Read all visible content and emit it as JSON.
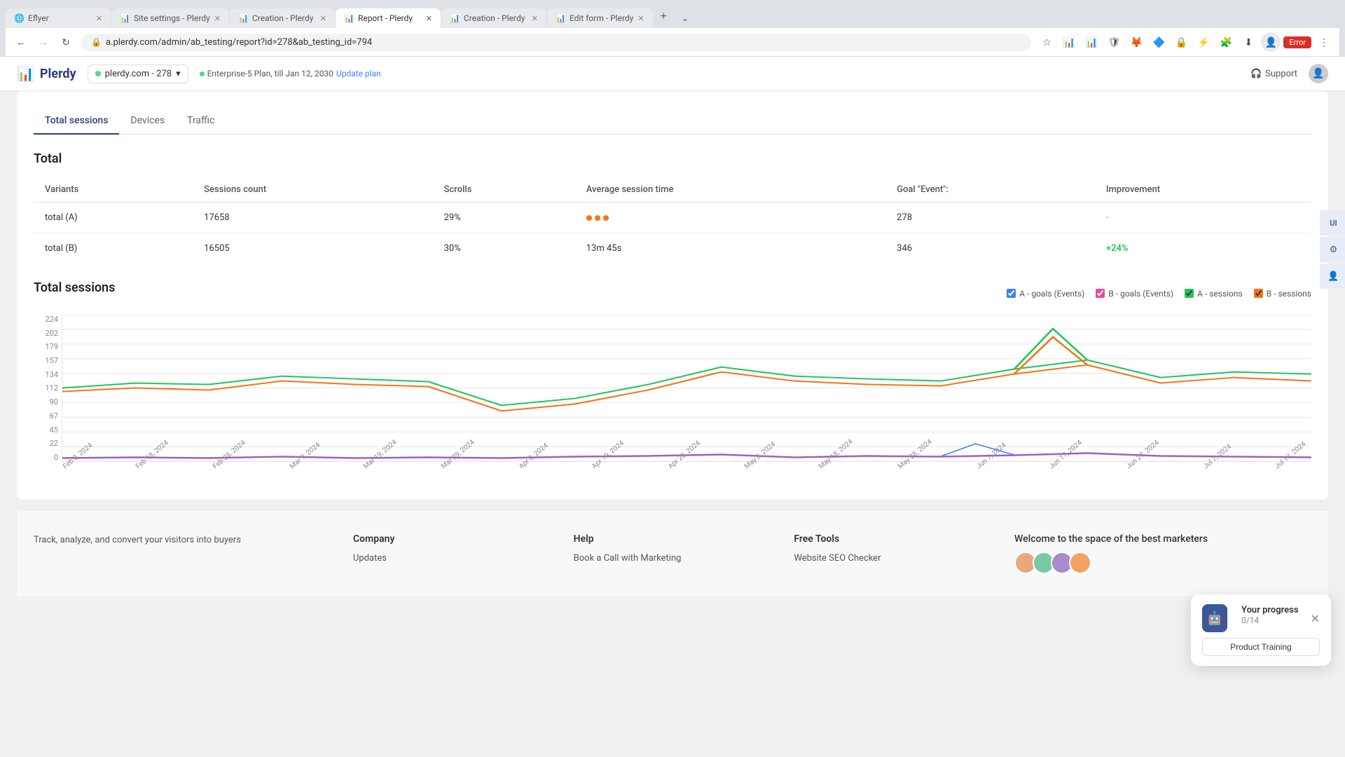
{
  "browser": {
    "tabs": [
      {
        "id": "tab1",
        "title": "Eflyer",
        "favicon": "🌐",
        "active": false
      },
      {
        "id": "tab2",
        "title": "Site settings - Plerdy",
        "favicon": "📊",
        "active": false
      },
      {
        "id": "tab3",
        "title": "Creation - Plerdy",
        "favicon": "📊",
        "active": false
      },
      {
        "id": "tab4",
        "title": "Report - Plerdy",
        "favicon": "📊",
        "active": true
      },
      {
        "id": "tab5",
        "title": "Creation - Plerdy",
        "favicon": "📊",
        "active": false
      },
      {
        "id": "tab6",
        "title": "Edit form - Plerdy",
        "favicon": "📊",
        "active": false
      }
    ],
    "url": "a.plerdy.com/admin/ab_testing/report?id=278&ab_testing_id=794",
    "error_badge": "Error"
  },
  "header": {
    "logo_text": "Plerdy",
    "site_selector": "plerdy.com - 278",
    "plan_text": "Enterprise-5 Plan, till Jan 12, 2030",
    "update_plan": "Update plan",
    "support_label": "Support"
  },
  "tabs": [
    {
      "id": "total_sessions",
      "label": "Total sessions",
      "active": true
    },
    {
      "id": "devices",
      "label": "Devices",
      "active": false
    },
    {
      "id": "traffic",
      "label": "Traffic",
      "active": false
    }
  ],
  "total_section": {
    "title": "Total",
    "table": {
      "headers": [
        "Variants",
        "Sessions count",
        "Scrolls",
        "Average session time",
        "Goal \"Event\":",
        "Improvement"
      ],
      "rows": [
        {
          "variant": "total (A)",
          "sessions": "17658",
          "scrolls": "29%",
          "avg_time_type": "dots",
          "goal": "278",
          "improvement": "-"
        },
        {
          "variant": "total (B)",
          "sessions": "16505",
          "scrolls": "30%",
          "avg_time": "13m 45s",
          "avg_time_type": "text",
          "goal": "346",
          "improvement": "+24%"
        }
      ]
    }
  },
  "chart": {
    "title": "Total sessions",
    "legend": [
      {
        "id": "a_goals",
        "label": "A - goals (Events)",
        "color": "#3b82f6",
        "type": "checkbox"
      },
      {
        "id": "b_goals",
        "label": "B - goals (Events)",
        "color": "#ec4899",
        "type": "checkbox"
      },
      {
        "id": "a_sessions",
        "label": "A - sessions",
        "color": "#22c55e",
        "type": "checkbox"
      },
      {
        "id": "b_sessions",
        "label": "B - sessions",
        "color": "#f97316",
        "type": "checkbox"
      }
    ],
    "y_labels": [
      "224",
      "202",
      "179",
      "157",
      "134",
      "112",
      "90",
      "67",
      "45",
      "22",
      "0"
    ],
    "x_labels": [
      "Feb 8, 2024",
      "Feb 18, 2024",
      "Feb 28, 2024",
      "Mar 9, 2024",
      "Mar 19, 2024",
      "Mar 29, 2024",
      "Apr 8, 2024",
      "Apr 19, 2024",
      "Apr 28, 2024",
      "May 8, 2024",
      "May 18, 2024",
      "May 28, 2024",
      "Jun 7, 2024",
      "Jun 17, 2024",
      "Jun 27, 2024",
      "Jul 7, 2024",
      "Jul 17, 2024"
    ]
  },
  "right_sidebar": {
    "icons": [
      "UI",
      "⚙",
      "👤"
    ]
  },
  "progress_widget": {
    "title": "Your progress",
    "count": "0/14",
    "btn_label": "Product Training"
  },
  "footer": {
    "brand_text": "Track, analyze, and convert your visitors into buyers",
    "columns": [
      {
        "title": "Company",
        "links": [
          "Updates"
        ]
      },
      {
        "title": "Help",
        "links": [
          "Book a Call with Marketing"
        ]
      },
      {
        "title": "Free Tools",
        "links": [
          "Website SEO Checker"
        ]
      }
    ],
    "community_title": "Welcome to the space of the best marketers"
  }
}
